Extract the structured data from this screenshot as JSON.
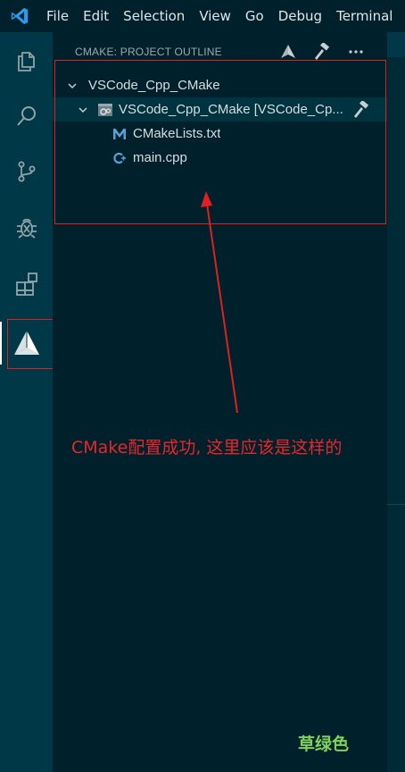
{
  "menubar": {
    "items": [
      "File",
      "Edit",
      "Selection",
      "View",
      "Go",
      "Debug",
      "Terminal"
    ]
  },
  "activity_bar": {
    "icons": [
      "files-icon",
      "search-icon",
      "source-control-icon",
      "debug-icon",
      "extensions-icon",
      "cmake-icon"
    ],
    "active": "cmake-icon"
  },
  "panel": {
    "title": "CMAKE: PROJECT OUTLINE",
    "actions": [
      "configure-icon",
      "build-icon",
      "more-icon"
    ]
  },
  "tree": {
    "project": "VSCode_Cpp_CMake",
    "target": "VSCode_Cpp_CMake [VSCode_Cp...",
    "files": [
      "CMakeLists.txt",
      "main.cpp"
    ]
  },
  "annotation": {
    "text": "CMake配置成功, 这里应该是这样的"
  },
  "watermark": "草绿色",
  "colors": {
    "sidebar_bg": "#00212b",
    "activity_bg": "#003847",
    "editor_bg": "#002b36",
    "annotation_red": "#e02020",
    "watermark_green": "#7fd35a"
  }
}
